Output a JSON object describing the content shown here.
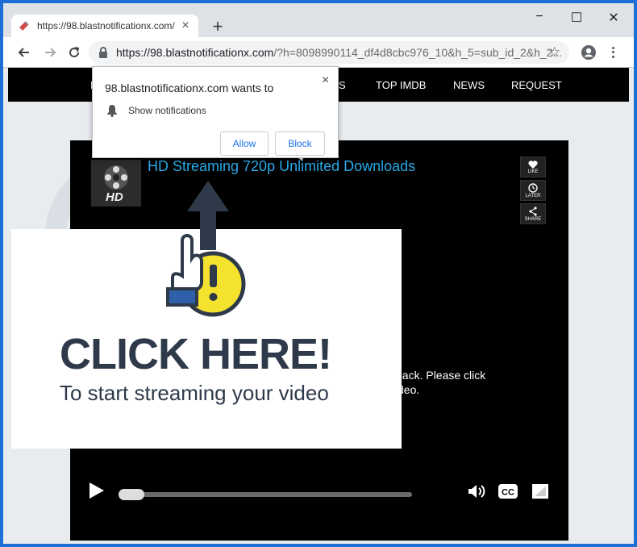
{
  "tab": {
    "title": "https://98.blastnotificationx.com/",
    "close": "×"
  },
  "newtab": "+",
  "window_controls": {
    "minimize": "−",
    "maximize": "☐",
    "close": "✕"
  },
  "address": {
    "host": "https://98.blastnotificationx.com",
    "path": "/?h=8098990114_df4d8cbc976_10&h_5=sub_id_2&h_2..."
  },
  "site_nav": {
    "items": [
      {
        "label": "H"
      },
      {
        "label": "S"
      },
      {
        "label": "TOP IMDB"
      },
      {
        "label": "NEWS"
      },
      {
        "label": "REQUEST"
      }
    ]
  },
  "video": {
    "title": "HD Streaming   720p   Unlimited Downloads",
    "thumb_label": "HD",
    "side_buttons": [
      {
        "label": "LIKE",
        "icon": "heart-icon"
      },
      {
        "label": "LATER",
        "icon": "clock-icon"
      },
      {
        "label": "SHARE",
        "icon": "share-icon"
      }
    ],
    "message_line1": "back. Please click",
    "message_line2": "deo."
  },
  "overlay": {
    "headline": "CLICK HERE!",
    "subline": "To start streaming your video"
  },
  "popup": {
    "title": "98.blastnotificationx.com wants to",
    "permission": "Show notifications",
    "allow": "Allow",
    "block": "Block",
    "close": "×"
  },
  "colors": {
    "accent": "#1a73e8",
    "video_title": "#29a9e8",
    "overlay_text": "#2e3a4a",
    "arrow_orange": "#f07d1a",
    "warning_yellow": "#f4e22e"
  }
}
